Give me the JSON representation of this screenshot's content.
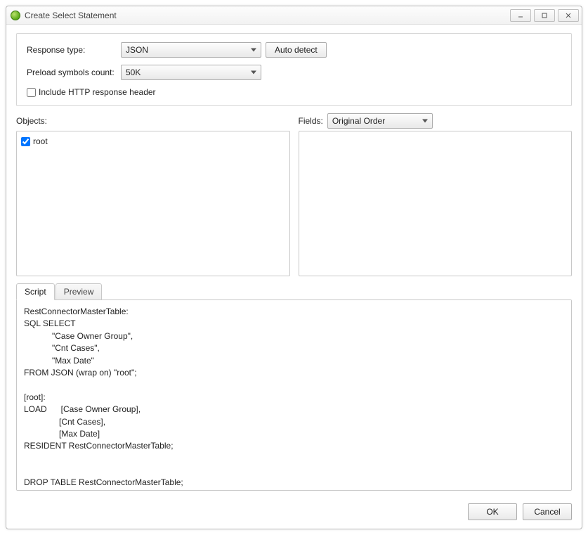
{
  "window": {
    "title": "Create Select Statement"
  },
  "config": {
    "response_type_label": "Response type:",
    "response_type_value": "JSON",
    "auto_detect_label": "Auto detect",
    "preload_label": "Preload symbols count:",
    "preload_value": "50K",
    "include_header_label": "Include HTTP response header",
    "include_header_checked": false
  },
  "objects": {
    "label": "Objects:",
    "items": [
      {
        "label": "root",
        "checked": true
      }
    ]
  },
  "fields": {
    "label": "Fields:",
    "order_value": "Original Order"
  },
  "tabs": {
    "script_label": "Script",
    "preview_label": "Preview"
  },
  "script_text": "RestConnectorMasterTable:\nSQL SELECT\n            \"Case Owner Group\",\n            \"Cnt Cases\",\n            \"Max Date\"\nFROM JSON (wrap on) \"root\";\n\n[root]:\nLOAD      [Case Owner Group],\n               [Cnt Cases],\n               [Max Date]\nRESIDENT RestConnectorMasterTable;\n\n\nDROP TABLE RestConnectorMasterTable;",
  "footer": {
    "ok_label": "OK",
    "cancel_label": "Cancel"
  }
}
